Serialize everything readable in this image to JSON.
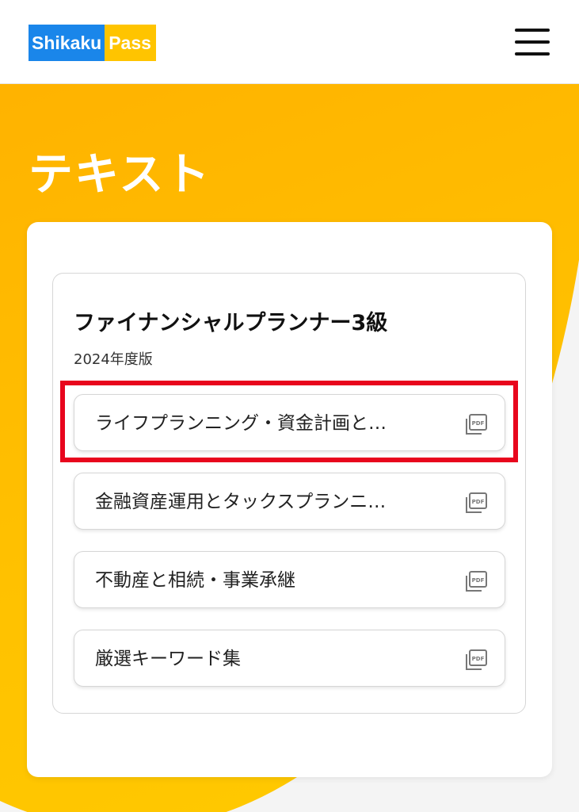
{
  "header": {
    "logo_part1": "Shikaku",
    "logo_part2": "Pass",
    "menu_icon": "hamburger-menu-icon"
  },
  "page": {
    "title": "テキスト"
  },
  "book": {
    "title": "ファイナンシャルプランナー3級",
    "edition": "2024年度版",
    "chapters": [
      {
        "label": "ライフプランニング・資金計画と…",
        "icon": "pdf-icon",
        "highlighted": true
      },
      {
        "label": "金融資産運用とタックスプランニ…",
        "icon": "pdf-icon"
      },
      {
        "label": "不動産と相続・事業承継",
        "icon": "pdf-icon"
      },
      {
        "label": "厳選キーワード集",
        "icon": "pdf-icon"
      }
    ]
  },
  "colors": {
    "brand_blue": "#1a86ea",
    "brand_yellow": "#ffc400",
    "hero_orange": "#fe9a00",
    "highlight_red": "#e8061d"
  }
}
